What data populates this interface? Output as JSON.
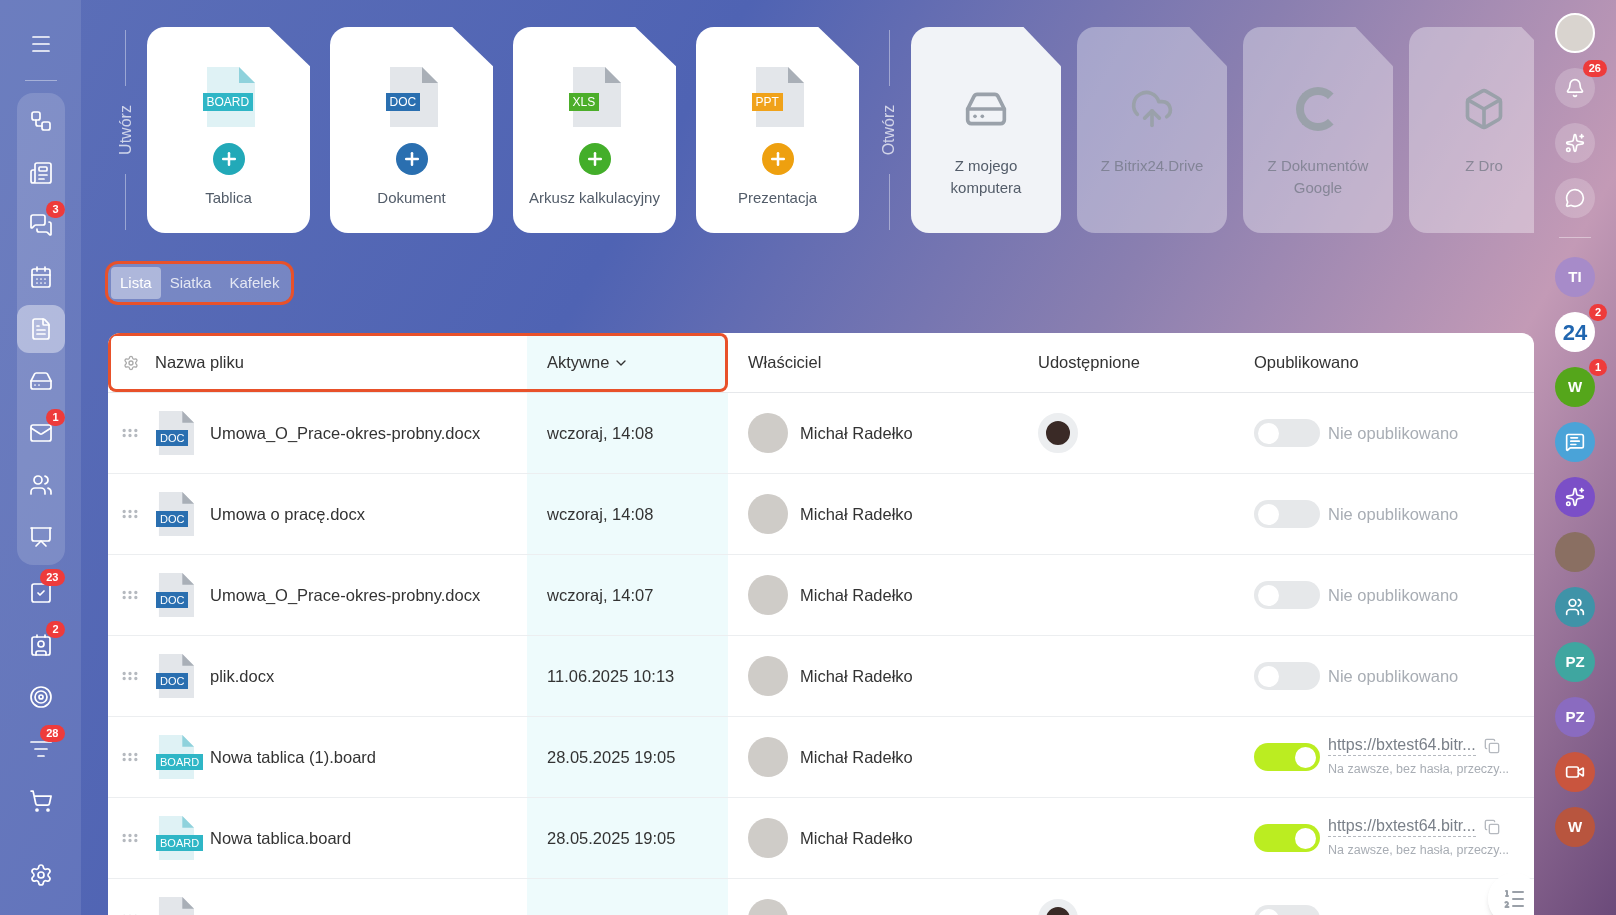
{
  "left_sidebar": {
    "top": [
      {
        "kind": "menu",
        "selected": false
      }
    ],
    "pinned": [
      {
        "kind": "flow",
        "selected": false
      },
      {
        "kind": "news",
        "selected": false
      },
      {
        "kind": "chat",
        "badge": "3",
        "selected": false
      },
      {
        "kind": "calendar",
        "selected": false
      },
      {
        "kind": "docs",
        "selected": true
      },
      {
        "kind": "drive",
        "selected": false
      },
      {
        "kind": "mail",
        "badge": "1",
        "selected": false
      },
      {
        "kind": "people",
        "selected": false
      },
      {
        "kind": "board",
        "selected": false
      }
    ],
    "items": [
      {
        "kind": "tasks",
        "badge": "23",
        "selected": false
      },
      {
        "kind": "crm",
        "badge": "2",
        "selected": false
      },
      {
        "kind": "target",
        "selected": false
      },
      {
        "kind": "funnel",
        "badge": "28",
        "selected": false
      },
      {
        "kind": "cart",
        "selected": false
      }
    ],
    "bottom": [
      {
        "kind": "settings",
        "selected": false
      }
    ]
  },
  "create_section": {
    "label": "Utwórz",
    "cards": [
      {
        "kind": "board",
        "tag": "BOARD",
        "label": "Tablica"
      },
      {
        "kind": "doc",
        "tag": "DOC",
        "label": "Dokument"
      },
      {
        "kind": "xls",
        "tag": "XLS",
        "label": "Arkusz kalkulacyjny"
      },
      {
        "kind": "ppt",
        "tag": "PPT",
        "label": "Prezentacja"
      }
    ]
  },
  "open_section": {
    "label": "Otwórz",
    "sources": [
      {
        "kind": "computer",
        "label": "Z mojego komputera",
        "disabled": false
      },
      {
        "kind": "cloud",
        "label": "Z Bitrix24.Drive",
        "disabled": true
      },
      {
        "kind": "google",
        "label": "Z Dokumentów Google",
        "disabled": true
      },
      {
        "kind": "dropbox",
        "label": "Z Dro",
        "disabled": true
      }
    ]
  },
  "view_switcher": {
    "highlighted": true,
    "options": [
      {
        "label": "Lista",
        "selected": true
      },
      {
        "label": "Siatka",
        "selected": false
      },
      {
        "label": "Kafelek",
        "selected": false
      }
    ]
  },
  "table": {
    "columns": [
      {
        "label": "Nazwa pliku",
        "sorted": false,
        "highlighted": true
      },
      {
        "label": "Aktywne",
        "sorted": true,
        "highlighted": true
      },
      {
        "label": "Właściciel",
        "sorted": false,
        "highlighted": false
      },
      {
        "label": "Udostępnione",
        "sorted": false,
        "highlighted": false
      },
      {
        "label": "Opublikowano",
        "sorted": false,
        "highlighted": false
      }
    ],
    "rows": [
      {
        "kind": "doc",
        "tag": "DOC",
        "name": "Umowa_O_Prace-okres-probny.docx",
        "modified": "wczoraj, 14:08",
        "owner": "Michał Radełko",
        "shared": true,
        "published": false,
        "status": "Nie opublikowano"
      },
      {
        "kind": "doc",
        "tag": "DOC",
        "name": "Umowa o pracę.docx",
        "modified": "wczoraj, 14:08",
        "owner": "Michał Radełko",
        "shared": false,
        "published": false,
        "status": "Nie opublikowano"
      },
      {
        "kind": "doc",
        "tag": "DOC",
        "name": "Umowa_O_Prace-okres-probny.docx",
        "modified": "wczoraj, 14:07",
        "owner": "Michał Radełko",
        "shared": false,
        "published": false,
        "status": "Nie opublikowano"
      },
      {
        "kind": "doc",
        "tag": "DOC",
        "name": "plik.docx",
        "modified": "11.06.2025 10:13",
        "owner": "Michał Radełko",
        "shared": false,
        "published": false,
        "status": "Nie opublikowano"
      },
      {
        "kind": "board",
        "tag": "BOARD",
        "name": "Nowa tablica (1).board",
        "modified": "28.05.2025 19:05",
        "owner": "Michał Radełko",
        "shared": false,
        "published": true,
        "link": "https://bxtest64.bitr...",
        "link_note": "Na zawsze, bez hasła, przeczy..."
      },
      {
        "kind": "board",
        "tag": "BOARD",
        "name": "Nowa tablica.board",
        "modified": "28.05.2025 19:05",
        "owner": "Michał Radełko",
        "shared": false,
        "published": true,
        "link": "https://bxtest64.bitr...",
        "link_note": "Na zawsze, bez hasła, przeczy..."
      },
      {
        "kind": "doc",
        "shared": true,
        "published": false
      }
    ]
  },
  "right_bar": {
    "items": [
      {
        "kind": "avatar"
      },
      {
        "kind": "bell",
        "badge": "26"
      },
      {
        "kind": "sparkle"
      },
      {
        "kind": "chat"
      },
      {
        "kind": "divider"
      },
      {
        "kind": "initials",
        "text": "TI",
        "color": "#a78bc9"
      },
      {
        "kind": "b24",
        "text": "24",
        "color": "#2066b0",
        "badge": "2"
      },
      {
        "kind": "initials",
        "text": "W",
        "color": "#55a61b",
        "badge": "1"
      },
      {
        "kind": "messages",
        "color": "#4aa3d8"
      },
      {
        "kind": "copilot",
        "color": "#7b4fc7"
      },
      {
        "kind": "photo"
      },
      {
        "kind": "group",
        "color": "#3f93a8"
      },
      {
        "kind": "initials",
        "text": "PZ",
        "color": "#3fa6a0"
      },
      {
        "kind": "initials",
        "text": "PZ",
        "color": "#8a6bc0"
      },
      {
        "kind": "video",
        "color": "#c9553e"
      },
      {
        "kind": "initials",
        "text": "W",
        "color": "#b8553e"
      }
    ]
  }
}
